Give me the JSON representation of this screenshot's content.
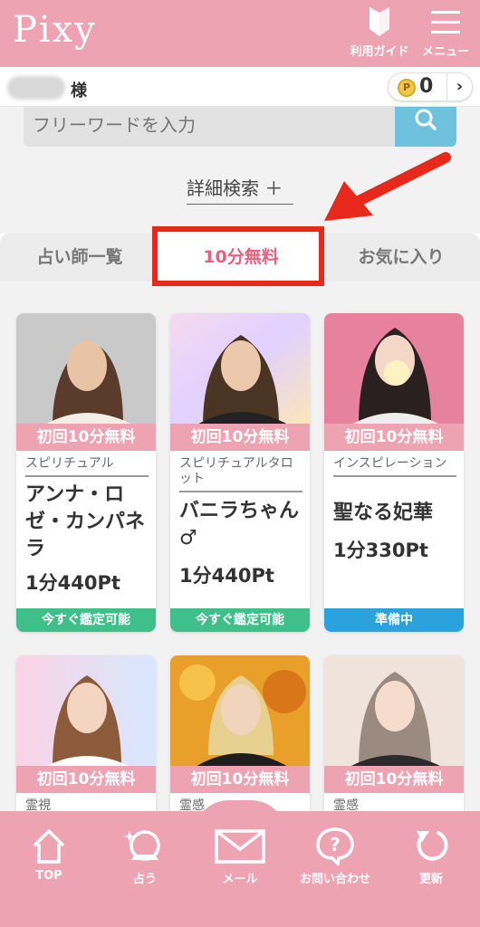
{
  "header": {
    "logo": "Pixy",
    "guide_label": "利用ガイド",
    "menu_label": "メニュー"
  },
  "user": {
    "honorific": "様",
    "points": "0",
    "coin_symbol": "P"
  },
  "search": {
    "placeholder": "フリーワードを入力",
    "advanced_label": "詳細検索 ＋"
  },
  "tabs": [
    {
      "label": "占い師一覧",
      "active": false
    },
    {
      "label": "10分無料",
      "active": true
    },
    {
      "label": "お気に入り",
      "active": false
    }
  ],
  "cards": [
    {
      "free_badge": "初回10分無料",
      "category": "スピリチュアル",
      "name": "アンナ・ロゼ・カンパネラ",
      "price": "1分440Pt",
      "status": "今すぐ鑑定可能",
      "status_color": "#3fbf8a"
    },
    {
      "free_badge": "初回10分無料",
      "category": "スピリチュアルタロット",
      "name": "バニラちゃん♂",
      "price": "1分440Pt",
      "status": "今すぐ鑑定可能",
      "status_color": "#3fbf8a"
    },
    {
      "free_badge": "初回10分無料",
      "category": "インスピレーション",
      "name": "聖なる妃華",
      "price": "1分330Pt",
      "status": "準備中",
      "status_color": "#2aa3dd"
    },
    {
      "free_badge": "初回10分無料",
      "category": "霊視"
    },
    {
      "free_badge": "初回10分無料",
      "category": "霊感"
    },
    {
      "free_badge": "初回10分無料",
      "category": "霊感"
    }
  ],
  "footer": [
    {
      "label": "TOP",
      "icon": "home-icon"
    },
    {
      "label": "占う",
      "icon": "crystal-ball-icon"
    },
    {
      "label": "メール",
      "icon": "mail-icon"
    },
    {
      "label": "お問い合わせ",
      "icon": "question-icon"
    },
    {
      "label": "更新",
      "icon": "refresh-icon"
    }
  ],
  "colors": {
    "brand_pink": "#eea3b3",
    "active_tab": "#e8607e",
    "search_button": "#6ec2de",
    "available": "#3fbf8a",
    "preparing": "#2aa3dd",
    "annotation_red": "#e8281b"
  }
}
